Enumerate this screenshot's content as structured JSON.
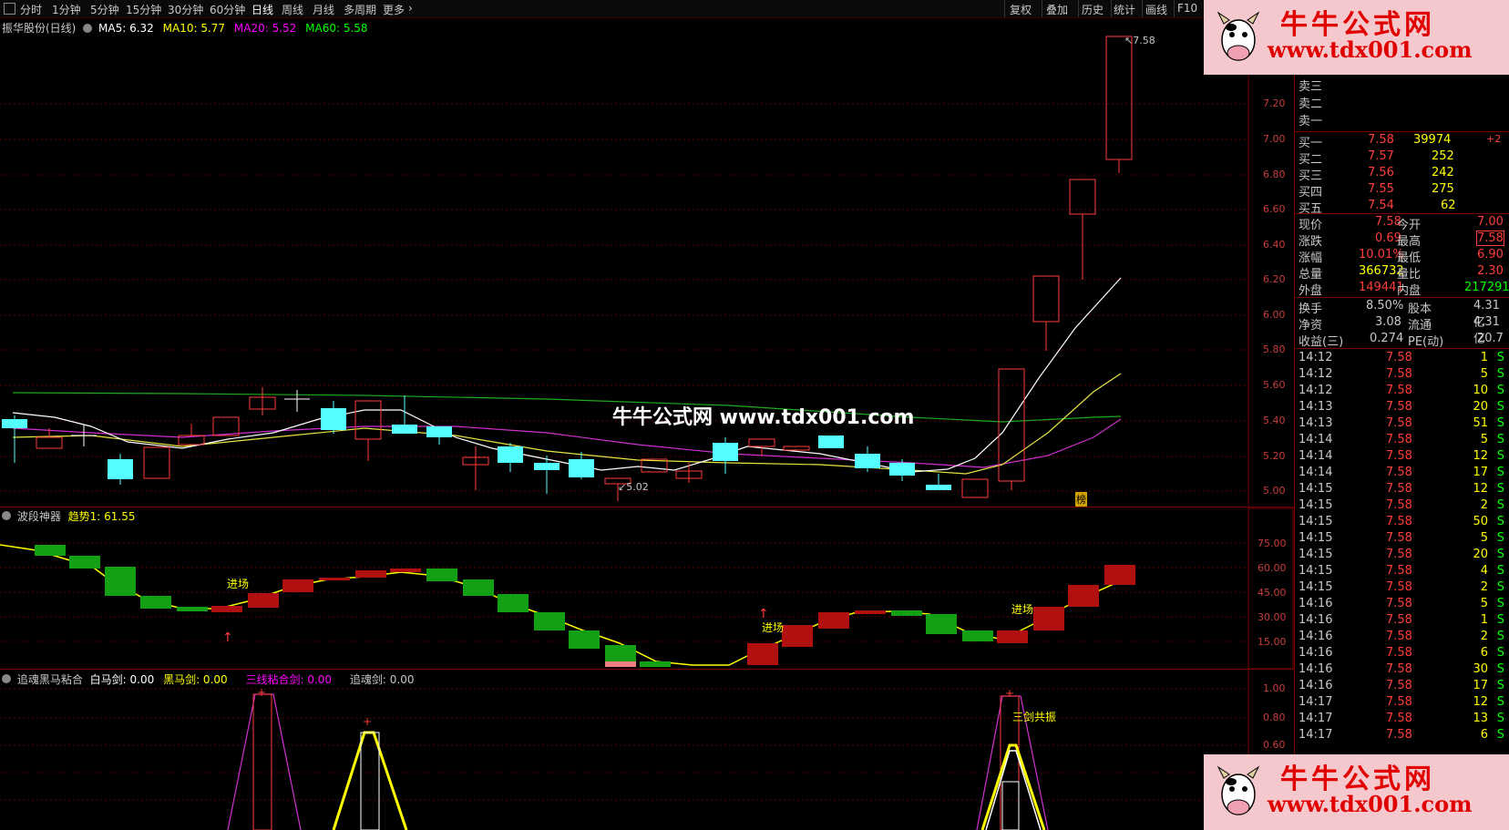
{
  "toolbar": {
    "periods": [
      "分时",
      "1分钟",
      "5分钟",
      "15分钟",
      "30分钟",
      "60分钟",
      "日线",
      "周线",
      "月线",
      "多周期",
      "更多"
    ],
    "active": "日线",
    "right_buttons": [
      "复权",
      "叠加",
      "历史",
      "统计",
      "画线",
      "F10"
    ]
  },
  "main_chart": {
    "stock_title": "振华股份(日线)",
    "ma5": "MA5: 6.32",
    "ma10": "MA10: 5.77",
    "ma20": "MA20: 5.52",
    "ma60": "MA60: 5.58",
    "y_ticks": [
      "7.20",
      "7.00",
      "6.80",
      "6.60",
      "6.40",
      "6.20",
      "6.00",
      "5.80",
      "5.60",
      "5.40",
      "5.20",
      "5.00"
    ],
    "high_label": "7.58",
    "low_label": "5.02",
    "badge": "榜",
    "colors": {
      "ma5": "#ffffff",
      "ma10": "#ffff00",
      "ma20": "#ff00ff",
      "ma60": "#00ff00",
      "up": "#ff3c3c",
      "down": "#54ffff"
    }
  },
  "watermark": "牛牛公式网 www.tdx001.com",
  "ad": {
    "title": "牛牛公式网",
    "url": "www.tdx001.com"
  },
  "indicator1": {
    "name": "波段神器",
    "value": "趋势1: 61.55",
    "y_ticks": [
      "75.00",
      "60.00",
      "45.00",
      "30.00",
      "15.00"
    ],
    "labels": [
      "进场",
      "进场",
      "进场"
    ]
  },
  "indicator2": {
    "name": "追魂黑马粘合",
    "white": "白马剑: 0.00",
    "black": "黑马剑: 0.00",
    "three": "三线粘合剑: 0.00",
    "chase": "追魂剑: 0.00",
    "y_ticks": [
      "1.00",
      "0.80",
      "0.60"
    ],
    "label": "三剑共振"
  },
  "quote": {
    "sell": [
      {
        "label": "卖三"
      },
      {
        "label": "卖二"
      },
      {
        "label": "卖一"
      }
    ],
    "buy": [
      {
        "label": "买一",
        "price": "7.58",
        "vol": "39974",
        "extra": "+2"
      },
      {
        "label": "买二",
        "price": "7.57",
        "vol": "252"
      },
      {
        "label": "买三",
        "price": "7.56",
        "vol": "242"
      },
      {
        "label": "买四",
        "price": "7.55",
        "vol": "275"
      },
      {
        "label": "买五",
        "price": "7.54",
        "vol": "62"
      }
    ],
    "stats1": [
      {
        "l1": "现价",
        "v1": "7.58",
        "l2": "今开",
        "v2": "7.00"
      },
      {
        "l1": "涨跌",
        "v1": "0.69",
        "l2": "最高",
        "v2": "7.58"
      },
      {
        "l1": "涨幅",
        "v1": "10.01%",
        "l2": "最低",
        "v2": "6.90"
      },
      {
        "l1": "总量",
        "v1": "366732",
        "l2": "量比",
        "v2": "2.30"
      },
      {
        "l1": "外盘",
        "v1": "149441",
        "l2": "内盘",
        "v2": "217291"
      }
    ],
    "stats2": [
      {
        "l1": "换手",
        "v1": "8.50%",
        "l2": "股本",
        "v2": "4.31亿"
      },
      {
        "l1": "净资",
        "v1": "3.08",
        "l2": "流通",
        "v2": "4.31亿"
      },
      {
        "l1": "收益(三)",
        "v1": "0.274",
        "l2": "PE(动)",
        "v2": "20.7"
      }
    ],
    "ticks": [
      {
        "t": "14:12",
        "p": "7.58",
        "v": "1",
        "s": "S"
      },
      {
        "t": "14:12",
        "p": "7.58",
        "v": "5",
        "s": "S"
      },
      {
        "t": "14:12",
        "p": "7.58",
        "v": "10",
        "s": "S"
      },
      {
        "t": "14:13",
        "p": "7.58",
        "v": "20",
        "s": "S"
      },
      {
        "t": "14:13",
        "p": "7.58",
        "v": "51",
        "s": "S"
      },
      {
        "t": "14:14",
        "p": "7.58",
        "v": "5",
        "s": "S"
      },
      {
        "t": "14:14",
        "p": "7.58",
        "v": "12",
        "s": "S"
      },
      {
        "t": "14:14",
        "p": "7.58",
        "v": "17",
        "s": "S"
      },
      {
        "t": "14:15",
        "p": "7.58",
        "v": "12",
        "s": "S"
      },
      {
        "t": "14:15",
        "p": "7.58",
        "v": "2",
        "s": "S"
      },
      {
        "t": "14:15",
        "p": "7.58",
        "v": "50",
        "s": "S"
      },
      {
        "t": "14:15",
        "p": "7.58",
        "v": "5",
        "s": "S"
      },
      {
        "t": "14:15",
        "p": "7.58",
        "v": "20",
        "s": "S"
      },
      {
        "t": "14:15",
        "p": "7.58",
        "v": "4",
        "s": "S"
      },
      {
        "t": "14:15",
        "p": "7.58",
        "v": "2",
        "s": "S"
      },
      {
        "t": "14:16",
        "p": "7.58",
        "v": "5",
        "s": "S"
      },
      {
        "t": "14:16",
        "p": "7.58",
        "v": "1",
        "s": "S"
      },
      {
        "t": "14:16",
        "p": "7.58",
        "v": "2",
        "s": "S"
      },
      {
        "t": "14:16",
        "p": "7.58",
        "v": "6",
        "s": "S"
      },
      {
        "t": "14:16",
        "p": "7.58",
        "v": "30",
        "s": "S"
      },
      {
        "t": "14:16",
        "p": "7.58",
        "v": "17",
        "s": "S"
      },
      {
        "t": "14:17",
        "p": "7.58",
        "v": "12",
        "s": "S"
      },
      {
        "t": "14:17",
        "p": "7.58",
        "v": "13",
        "s": "S"
      },
      {
        "t": "14:17",
        "p": "7.58",
        "v": "6",
        "s": "S"
      }
    ]
  }
}
